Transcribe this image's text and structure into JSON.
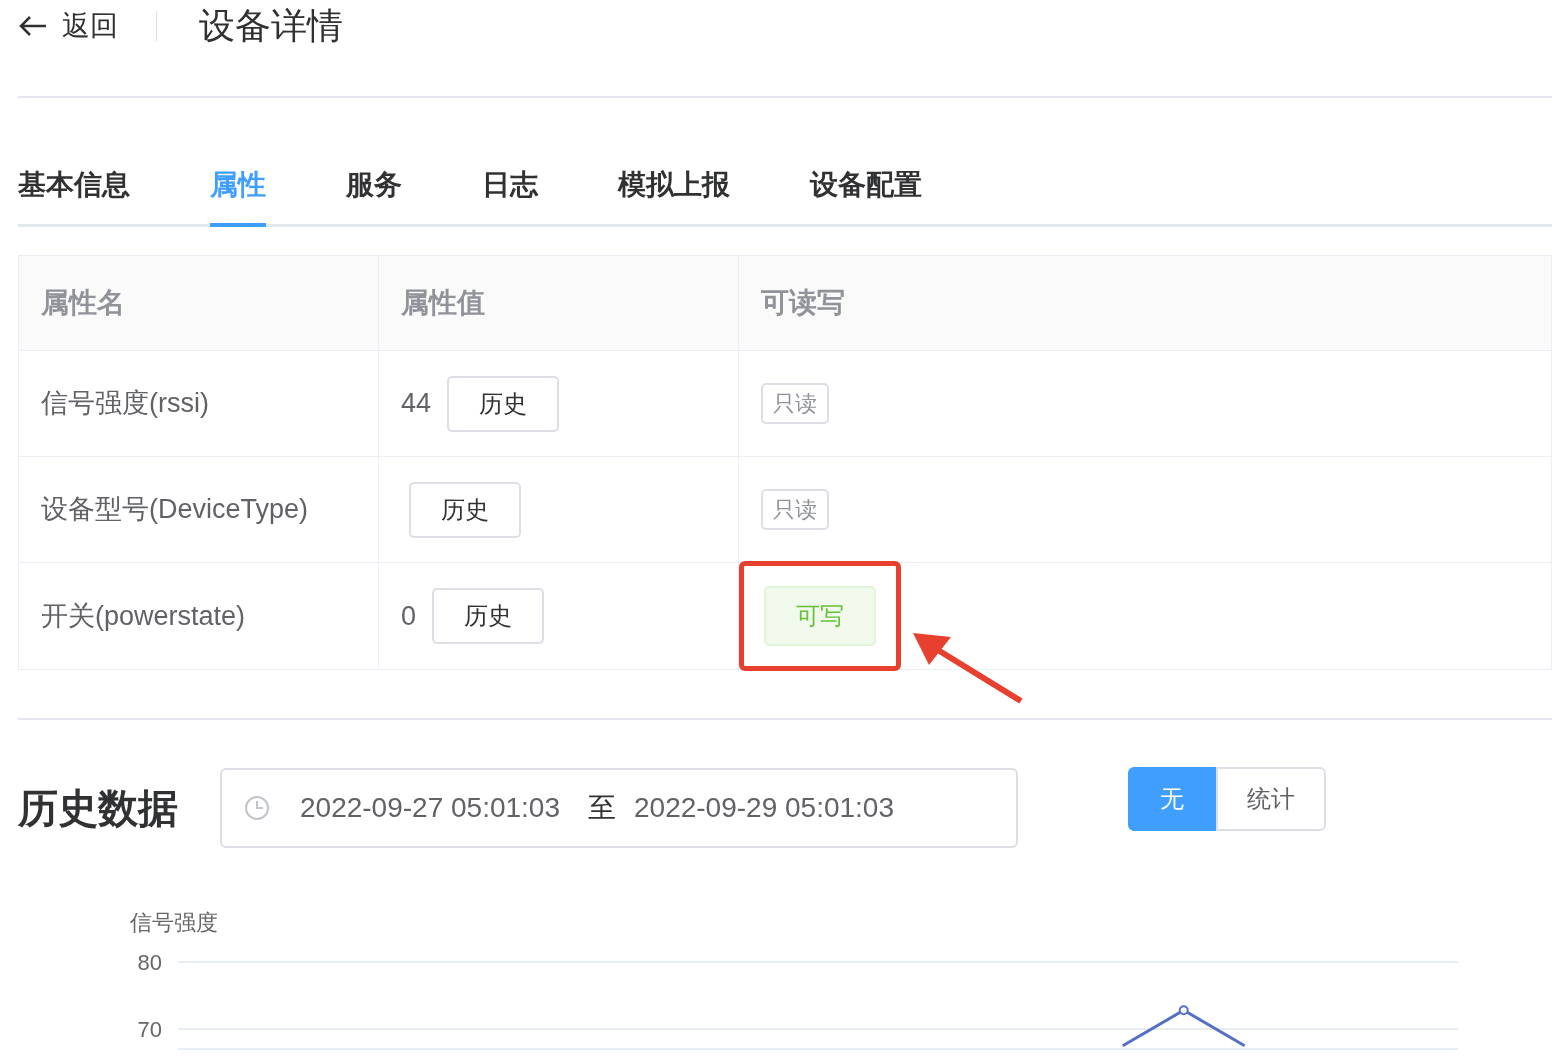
{
  "header": {
    "back_label": "返回",
    "title": "设备详情"
  },
  "tabs": [
    {
      "label": "基本信息",
      "selected": false
    },
    {
      "label": "属性",
      "selected": true
    },
    {
      "label": "服务",
      "selected": false
    },
    {
      "label": "日志",
      "selected": false
    },
    {
      "label": "模拟上报",
      "selected": false
    },
    {
      "label": "设备配置",
      "selected": false
    }
  ],
  "table": {
    "columns": [
      "属性名",
      "属性值",
      "可读写"
    ],
    "rows": [
      {
        "name": "信号强度(rssi)",
        "value": "44",
        "history_button": "历史",
        "access": "只读",
        "kind": "readonly",
        "highlighted": false
      },
      {
        "name": "设备型号(DeviceType)",
        "history_button": "历史",
        "access": "只读",
        "kind": "readonly",
        "highlighted": false
      },
      {
        "name": "开关(powerstate)",
        "value": "0",
        "history_button": "历史",
        "access": "可写",
        "kind": "writable",
        "highlighted": true
      }
    ]
  },
  "history": {
    "title": "历史数据",
    "start": "2022-09-27 05:01:03",
    "separator": "至",
    "end": "2022-09-29 05:01:03",
    "modes": [
      {
        "label": "无",
        "selected": true
      },
      {
        "label": "统计",
        "selected": false
      }
    ],
    "chart_data": {
      "type": "line",
      "ylim": [
        67,
        80
      ],
      "yticks": [
        70,
        80
      ],
      "categories": [
        null,
        null,
        null,
        null,
        null,
        null,
        null,
        null,
        null,
        null,
        null,
        null,
        null,
        null,
        null,
        null,
        null,
        null,
        null,
        null,
        null
      ],
      "series": [
        {
          "name": "信号强度",
          "color": "#5470c6",
          "values": [
            null,
            null,
            null,
            null,
            null,
            null,
            null,
            null,
            null,
            null,
            null,
            null,
            null,
            null,
            null,
            67.5,
            72.8,
            67.5,
            null,
            null,
            null
          ]
        }
      ]
    }
  }
}
